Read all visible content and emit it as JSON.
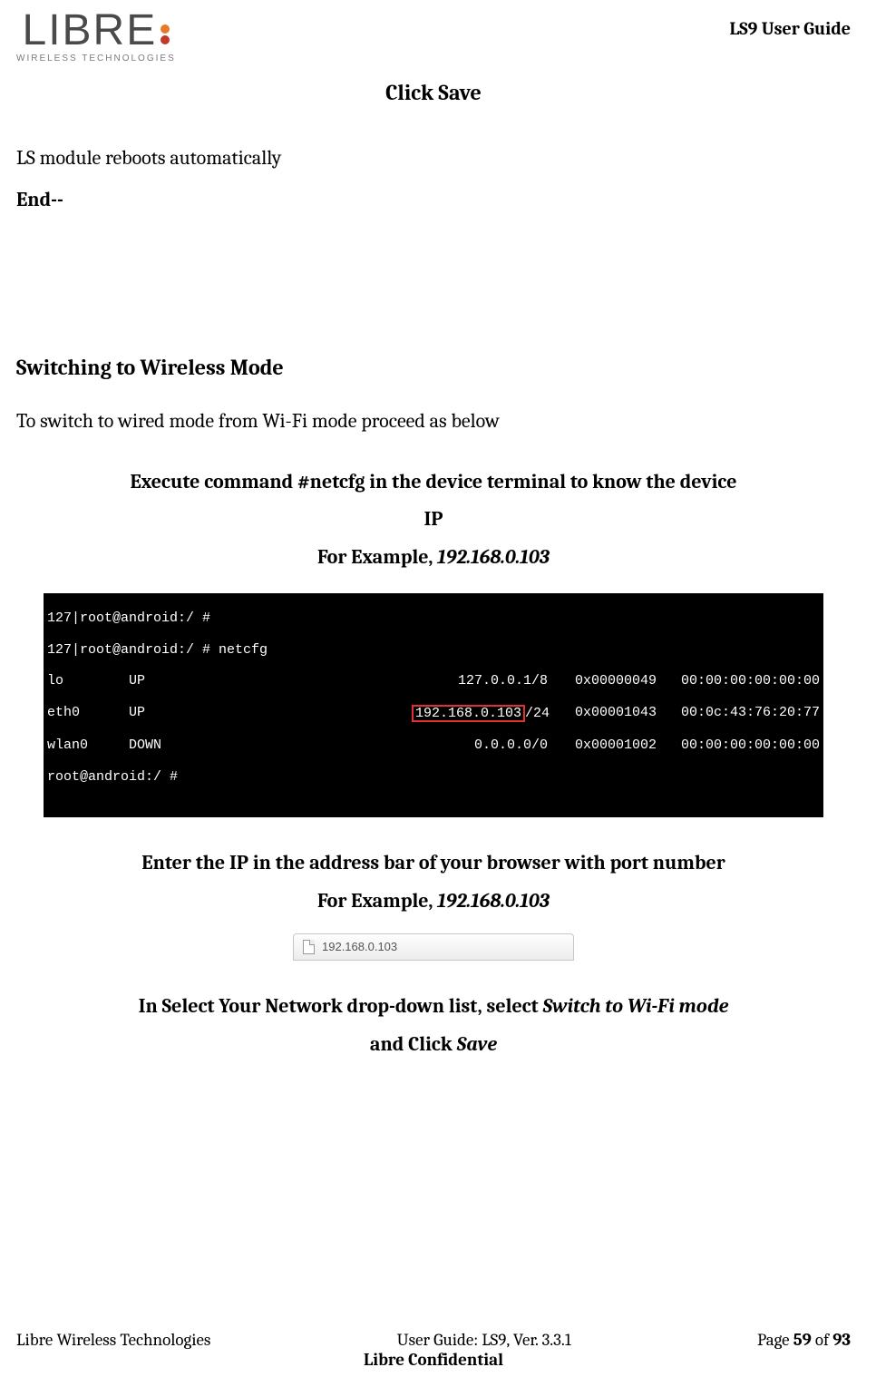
{
  "header": {
    "brand_main": "LIBRE",
    "brand_sub": "WIRELESS TECHNOLOGIES",
    "guide_title": "LS9 User Guide"
  },
  "body": {
    "click_save": "Click Save",
    "reboot_line": "LS module reboots automatically",
    "end_label": "End--",
    "section_heading": "Switching to Wireless Mode",
    "switch_intro": "To switch to wired mode from Wi-Fi mode proceed as below",
    "step1_line1": "Execute command #netcfg in the device terminal to know the device",
    "step1_line2": "IP",
    "step1_example_lead": "For Example, ",
    "step1_example_ip": "192.168.0.103",
    "terminal": {
      "prompt1": "127|root@android:/ #",
      "prompt2": "127|root@android:/ # netcfg",
      "rows": [
        {
          "if": "lo",
          "state": "UP",
          "addr": "127.0.0.1",
          "mask": "/8",
          "flags": "0x00000049",
          "mac": "00:00:00:00:00:00",
          "hl": false
        },
        {
          "if": "eth0",
          "state": "UP",
          "addr": "192.168.0.103",
          "mask": "/24",
          "flags": "0x00001043",
          "mac": "00:0c:43:76:20:77",
          "hl": true
        },
        {
          "if": "wlan0",
          "state": "DOWN",
          "addr": "0.0.0.0",
          "mask": "/0",
          "flags": "0x00001002",
          "mac": "00:00:00:00:00:00",
          "hl": false
        }
      ],
      "prompt3": "root@android:/ #"
    },
    "step2_line1": "Enter the IP in the address bar of your browser with port number",
    "step2_example_lead": "For Example, ",
    "step2_example_ip": "192.168.0.103",
    "browser_tab_text": "192.168.0.103",
    "step3_lead": "In Select Your Network drop-down list, select ",
    "step3_italic": "Switch to Wi-Fi mode",
    "step3_line2_lead": "and Click ",
    "step3_line2_italic": "Save"
  },
  "footer": {
    "left": "Libre Wireless Technologies",
    "center": "User Guide: LS9, Ver. 3.3.1",
    "page_label": "Page ",
    "page_current": "59",
    "page_of": " of ",
    "page_total": "93",
    "confidential": "Libre Confidential"
  }
}
